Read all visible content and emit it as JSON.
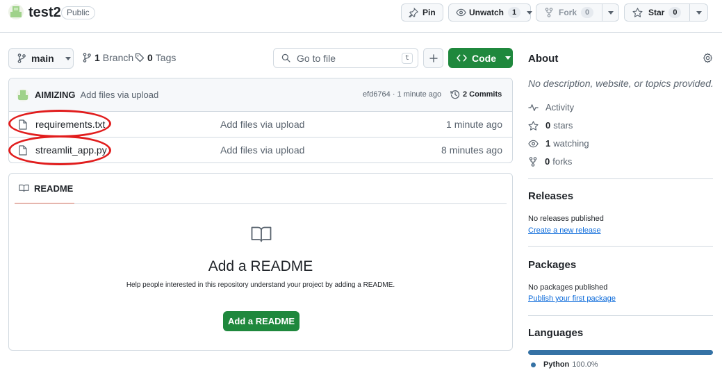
{
  "repo": {
    "name": "test2",
    "visibility": "Public"
  },
  "header_actions": {
    "pin_label": "Pin",
    "unwatch_label": "Unwatch",
    "watch_count": "1",
    "fork_label": "Fork",
    "fork_count": "0",
    "star_label": "Star",
    "star_count": "0"
  },
  "toolbar": {
    "branch": "main",
    "branch_count": "1",
    "branch_label": "Branch",
    "tag_count": "0",
    "tag_label": "Tags",
    "goto_placeholder": "Go to file",
    "goto_shortcut": "t",
    "code_label": "Code"
  },
  "latest_commit": {
    "author": "AIMIZING",
    "message": "Add files via upload",
    "hash_time": "efd6764 · 1 minute ago",
    "commits_label": "2 Commits"
  },
  "files": [
    {
      "name": "requirements.txt",
      "message": "Add files via upload",
      "time": "1 minute ago"
    },
    {
      "name": "streamlit_app.py",
      "message": "Add files via upload",
      "time": "8 minutes ago"
    }
  ],
  "readme": {
    "tab_label": "README",
    "title": "Add a README",
    "subtitle": "Help people interested in this repository understand your project by adding a README.",
    "button_label": "Add a README"
  },
  "about": {
    "heading": "About",
    "description": "No description, website, or topics provided.",
    "activity_label": "Activity",
    "stars_count": "0",
    "stars_label": "stars",
    "watching_count": "1",
    "watching_label": "watching",
    "forks_count": "0",
    "forks_label": "forks"
  },
  "releases": {
    "heading": "Releases",
    "empty_text": "No releases published",
    "link_label": "Create a new release"
  },
  "packages": {
    "heading": "Packages",
    "empty_text": "No packages published",
    "link_label": "Publish your first package"
  },
  "languages": {
    "heading": "Languages",
    "items": [
      {
        "name": "Python",
        "percent": "100.0%",
        "share": 1.0,
        "color": "#3572A5"
      }
    ]
  },
  "colors": {
    "primary_green": "#1f883d",
    "annotation_red": "#e11d1d",
    "link_blue": "#0969da",
    "readme_tab_accent": "#fd8c73"
  },
  "icons": [
    "repo-avatar-icon",
    "pin-icon",
    "eye-icon",
    "fork-icon",
    "star-icon",
    "branch-icon",
    "tag-icon",
    "search-icon",
    "plus-icon",
    "code-icon",
    "history-icon",
    "file-icon",
    "book-icon",
    "gear-icon",
    "pulse-icon"
  ]
}
